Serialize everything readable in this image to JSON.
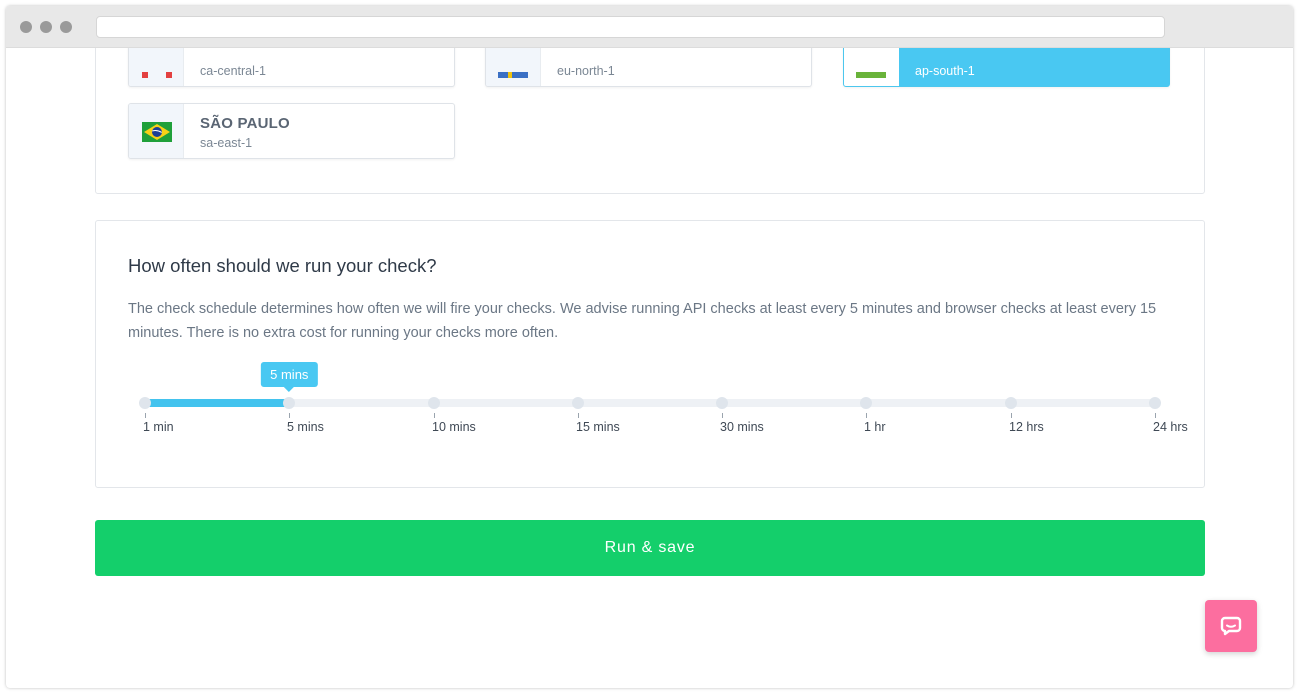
{
  "locations": {
    "items": [
      {
        "name": "",
        "code": "ca-central-1",
        "flag": "canada",
        "selected": false
      },
      {
        "name": "",
        "code": "eu-north-1",
        "flag": "sweden",
        "selected": false
      },
      {
        "name": "",
        "code": "ap-south-1",
        "flag": "india",
        "selected": true
      },
      {
        "name": "SÃO PAULO",
        "code": "sa-east-1",
        "flag": "brazil",
        "selected": false
      }
    ]
  },
  "schedule": {
    "title": "How often should we run your check?",
    "description": "The check schedule determines how often we will fire your checks. We advise running API checks at least every 5 minutes and browser checks at least every 15 minutes. There is no extra cost for running your checks more often.",
    "options": [
      "1 min",
      "5 mins",
      "10 mins",
      "15 mins",
      "30 mins",
      "1 hr",
      "12 hrs",
      "24 hrs"
    ],
    "selected_index": 1,
    "tooltip": "5 mins"
  },
  "actions": {
    "run_save_label": "Run & save"
  },
  "icons": {
    "chat": "chat-bubble-icon"
  },
  "colors": {
    "accent": "#49c8f2",
    "primary_button": "#14cf6b",
    "chat_button": "#fc6e9f"
  }
}
